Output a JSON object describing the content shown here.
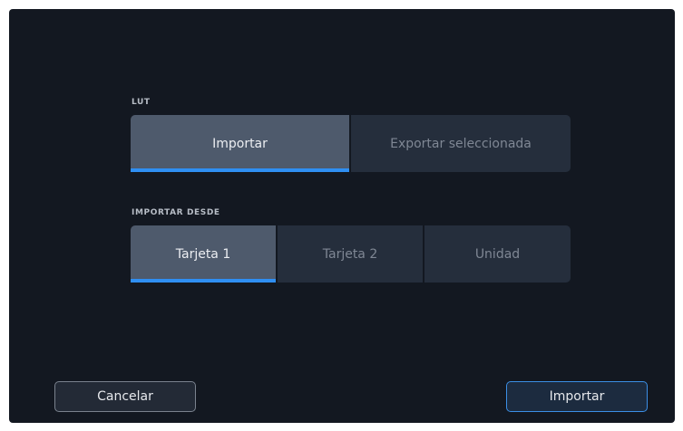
{
  "lut": {
    "label": "LUT",
    "options": [
      {
        "label": "Importar",
        "selected": true
      },
      {
        "label": "Exportar seleccionada",
        "selected": false
      }
    ]
  },
  "import_from": {
    "label": "IMPORTAR DESDE",
    "options": [
      {
        "label": "Tarjeta 1",
        "selected": true
      },
      {
        "label": "Tarjeta 2",
        "selected": false
      },
      {
        "label": "Unidad",
        "selected": false
      }
    ]
  },
  "footer": {
    "cancel_label": "Cancelar",
    "confirm_label": "Importar"
  },
  "colors": {
    "background": "#131821",
    "segment": "#252e3c",
    "segment_selected": "#4e5a6c",
    "accent": "#2f8ff3"
  }
}
